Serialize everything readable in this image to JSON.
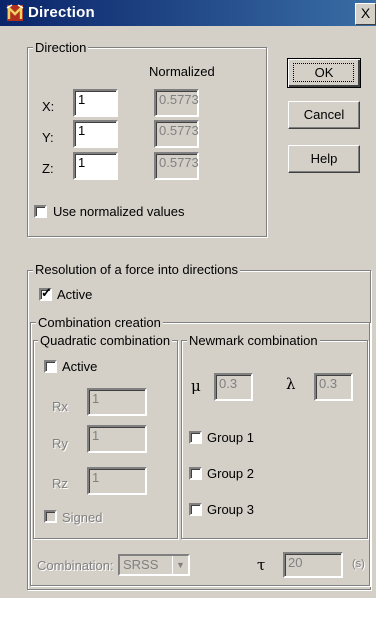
{
  "window": {
    "title": "Direction",
    "close_label": "X"
  },
  "direction": {
    "group_label": "Direction",
    "normalized_header": "Normalized",
    "rows": [
      {
        "label": "X:",
        "value": "1",
        "normalized": "0.5773"
      },
      {
        "label": "Y:",
        "value": "1",
        "normalized": "0.5773"
      },
      {
        "label": "Z:",
        "value": "1",
        "normalized": "0.5773"
      }
    ],
    "use_normalized_label": "Use normalized values",
    "use_normalized_checked": false
  },
  "buttons": {
    "ok": "OK",
    "cancel": "Cancel",
    "help": "Help"
  },
  "resolution": {
    "group_label": "Resolution of a force into directions",
    "active_label": "Active",
    "active_checked": true,
    "combination_label": "Combination creation",
    "quadratic": {
      "group_label": "Quadratic combination",
      "active_label": "Active",
      "fields": [
        {
          "label": "Rx",
          "value": "1"
        },
        {
          "label": "Ry",
          "value": "1"
        },
        {
          "label": "Rz",
          "value": "1"
        }
      ],
      "signed_label": "Signed"
    },
    "newmark": {
      "group_label": "Newmark combination",
      "mu_symbol": "μ",
      "mu_value": "0.3",
      "lambda_symbol": "λ",
      "lambda_value": "0.3",
      "groups": [
        "Group 1",
        "Group 2",
        "Group 3"
      ]
    },
    "combination": {
      "label": "Combination:",
      "selected": "SRSS",
      "tau_symbol": "τ",
      "tau_value": "20",
      "tau_unit": "(s)"
    }
  }
}
